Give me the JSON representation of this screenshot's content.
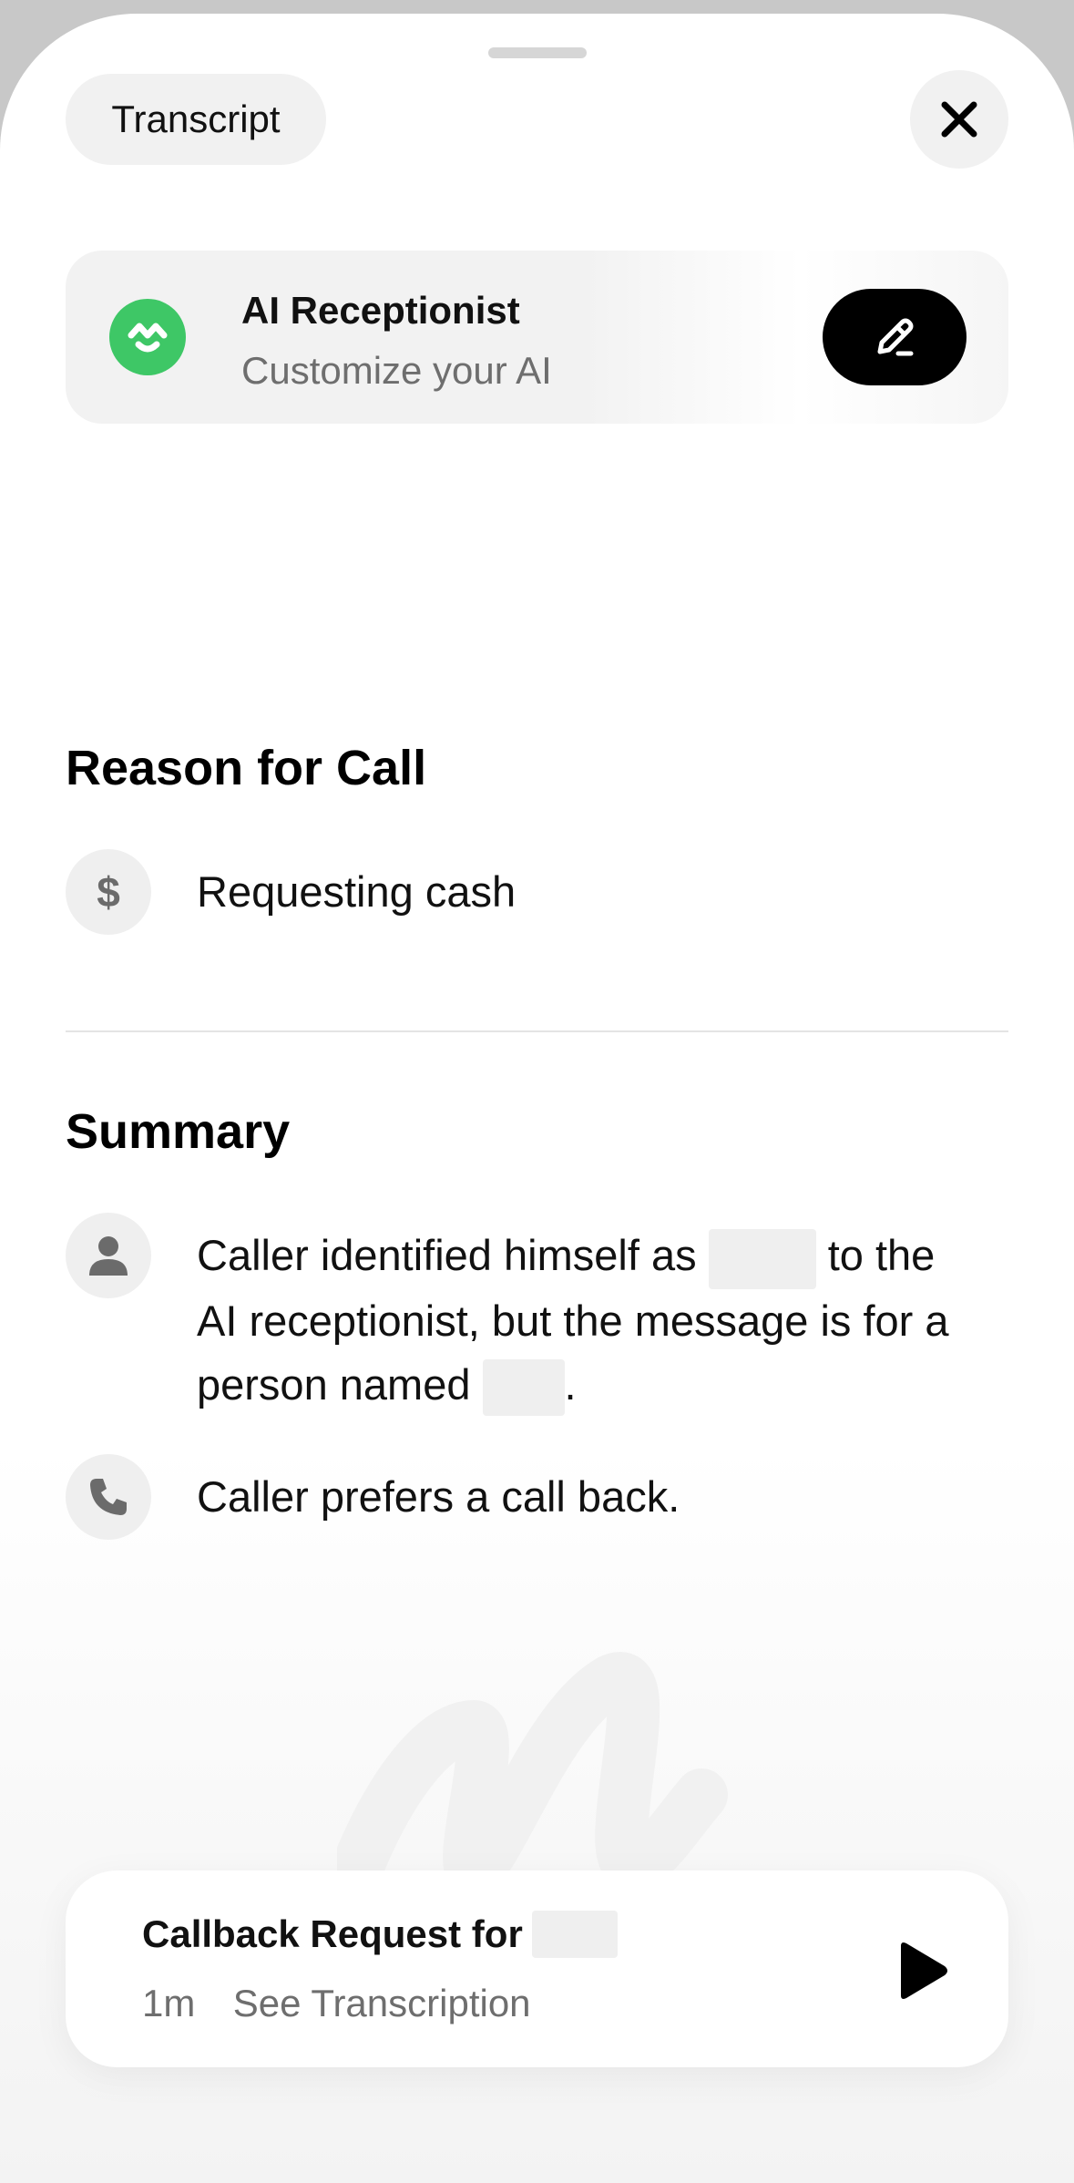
{
  "header": {
    "transcript_label": "Transcript"
  },
  "ai_card": {
    "title": "AI Receptionist",
    "subtitle": "Customize your AI",
    "logo_color": "#3ec766"
  },
  "reason": {
    "heading": "Reason for Call",
    "items": [
      {
        "icon": "dollar-icon",
        "text": "Requesting cash"
      }
    ]
  },
  "summary": {
    "heading": "Summary",
    "items": [
      {
        "icon": "person-icon",
        "line1_a": "Caller identified himself as",
        "line1_b": "to the",
        "line2": "AI receptionist, but the message is for a",
        "line3_a": "person named",
        "line3_b": "."
      },
      {
        "icon": "phone-icon",
        "text": "Caller prefers a call back."
      }
    ]
  },
  "voicemail": {
    "title": "Callback Request for",
    "duration": "1m",
    "link": "See Transcription"
  }
}
